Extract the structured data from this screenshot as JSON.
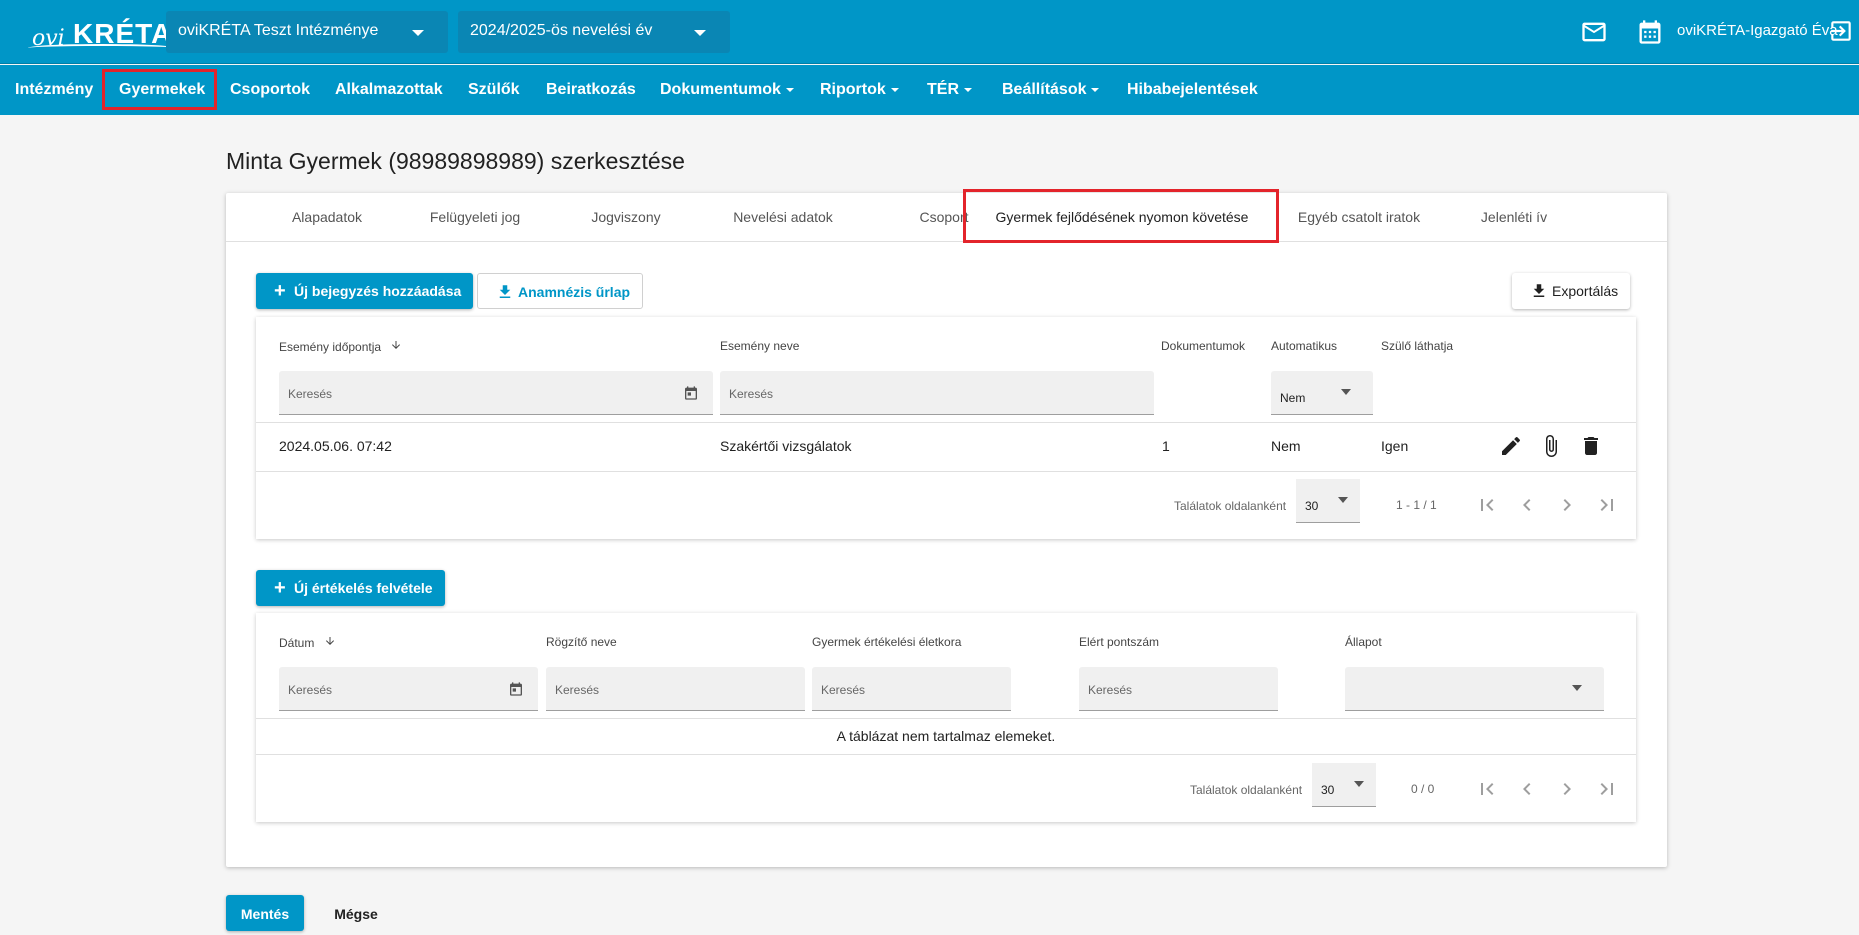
{
  "header": {
    "logo_text_ovi": "ovi",
    "logo_text_kreta": "KRÉTA",
    "institution": "oviKRÉTA Teszt Intézménye",
    "school_year": "2024/2025-ös nevelési év",
    "user_name": "oviKRÉTA-Igazgató Éva",
    "icons": [
      "mail-icon",
      "calendar-icon",
      "logout-icon"
    ]
  },
  "nav": {
    "items": [
      {
        "label": "Intézmény"
      },
      {
        "label": "Gyermekek"
      },
      {
        "label": "Csoportok"
      },
      {
        "label": "Alkalmazottak"
      },
      {
        "label": "Szülők"
      },
      {
        "label": "Beiratkozás"
      },
      {
        "label": "Dokumentumok"
      },
      {
        "label": "Riportok"
      },
      {
        "label": "TÉR"
      },
      {
        "label": "Beállítások"
      },
      {
        "label": "Hibabejelentések"
      }
    ],
    "active": "Gyermekek"
  },
  "page": {
    "title": "Minta Gyermek (98989898989) szerkesztése"
  },
  "tabs": [
    {
      "label": "Alapadatok"
    },
    {
      "label": "Felügyeleti jog"
    },
    {
      "label": "Jogviszony"
    },
    {
      "label": "Nevelési adatok"
    },
    {
      "label": "Csoport"
    },
    {
      "label": "Gyermek fejlődésének nyomon követése"
    },
    {
      "label": "Egyéb csatolt iratok"
    },
    {
      "label": "Jelenléti ív"
    }
  ],
  "events": {
    "add_button": "Új bejegyzés hozzáadása",
    "anamnesis_button": "Anamnézis űrlap",
    "export_button": "Exportálás",
    "columns": {
      "date": "Esemény időpontja",
      "name": "Esemény neve",
      "docs": "Dokumentumok",
      "auto": "Automatikus",
      "parent_visible": "Szülő láthatja"
    },
    "filters": {
      "date_placeholder": "Keresés",
      "name_placeholder": "Keresés",
      "auto_value": "Nem"
    },
    "rows": [
      {
        "date": "2024.05.06. 07:42",
        "name": "Szakértői vizsgálatok",
        "docs": "1",
        "auto": "Nem",
        "parent_visible": "Igen"
      }
    ],
    "pager": {
      "label": "Találatok oldalanként",
      "page_size": "30",
      "range": "1 - 1 / 1"
    }
  },
  "evaluations": {
    "add_button": "Új értékelés felvétele",
    "columns": {
      "date": "Dátum",
      "recorder": "Rögzítő neve",
      "age": "Gyermek értékelési életkora",
      "score": "Elért pontszám",
      "status": "Állapot"
    },
    "filters": {
      "date_placeholder": "Keresés",
      "recorder_placeholder": "Keresés",
      "age_placeholder": "Keresés",
      "score_placeholder": "Keresés"
    },
    "empty_text": "A táblázat nem tartalmaz elemeket.",
    "pager": {
      "label": "Találatok oldalanként",
      "page_size": "30",
      "range": "0 / 0"
    }
  },
  "footer": {
    "save": "Mentés",
    "cancel": "Mégse"
  },
  "colors": {
    "primary": "#0096c7",
    "highlight": "#e3242b"
  }
}
